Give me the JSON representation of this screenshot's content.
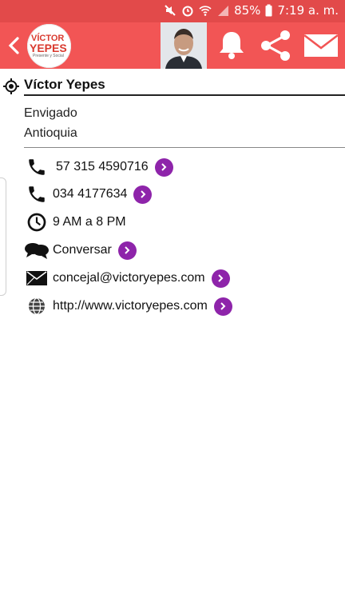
{
  "status_bar": {
    "battery": "85%",
    "time": "7:19 a. m."
  },
  "app_bar": {
    "logo": {
      "line1": "VÍCTOR",
      "line2": "YEPES",
      "line3": "Presente y Social"
    }
  },
  "profile": {
    "name": "Víctor Yepes",
    "city": "Envigado",
    "region": "Antioquia"
  },
  "contacts": [
    {
      "icon": "phone-icon",
      "text": "57 315 4590716",
      "action": true
    },
    {
      "icon": "phone-icon",
      "text": "034 4177634",
      "action": true
    },
    {
      "icon": "clock-icon",
      "text": "9 AM a 8 PM",
      "action": false
    },
    {
      "icon": "chat-icon",
      "text": "Conversar",
      "action": true
    },
    {
      "icon": "envelope-icon",
      "text": "concejal@victoryepes.com",
      "action": true
    },
    {
      "icon": "globe-icon",
      "text": "http://www.victoryepes.com",
      "action": true
    }
  ],
  "colors": {
    "app_bar": "#f25555",
    "status_bar": "#e24a4a",
    "action": "#8e24aa"
  }
}
